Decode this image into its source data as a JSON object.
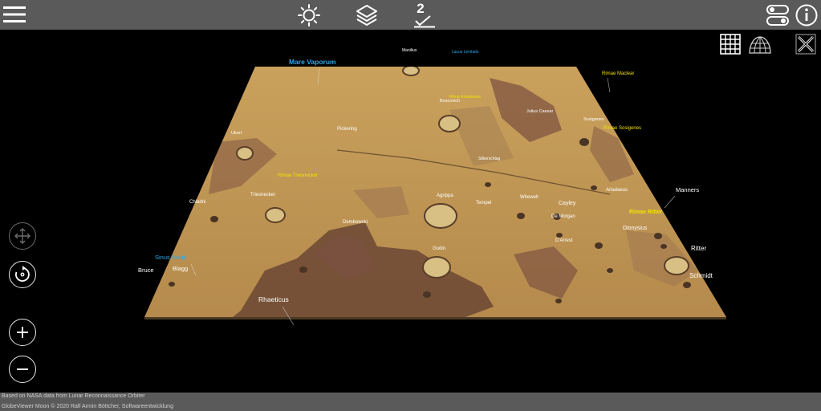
{
  "toolbar": {
    "menu_icon": "hamburger-icon",
    "sun_icon": "sun-icon",
    "layers_icon": "layers-icon",
    "exaggeration_value": "2",
    "settings_icon": "toggle-switches-icon",
    "info_icon": "info-icon"
  },
  "view_controls": {
    "grid_icon": "grid-icon",
    "globe_grid_icon": "globe-grid-icon",
    "close_icon": "close-x-icon"
  },
  "nav_controls": {
    "pan_icon": "pan-arrows-icon",
    "rotate_icon": "rotate-icon",
    "zoom_in_icon": "plus-icon",
    "zoom_out_icon": "minus-icon"
  },
  "colors": {
    "bar": "#5a5a5a",
    "label_white": "#ffffff",
    "label_yellow": "#f2e300",
    "label_blue": "#29a8f0"
  },
  "labels": [
    {
      "text": "Mare Vaporum",
      "color": "b"
    },
    {
      "text": "Manilius",
      "color": "w"
    },
    {
      "text": "Lacus Lenitatis",
      "color": "b"
    },
    {
      "text": "Rimae Maclear",
      "color": "y"
    },
    {
      "text": "Boscovich",
      "color": "w"
    },
    {
      "text": "Rima Ariadaeus",
      "color": "y"
    },
    {
      "text": "Julius Caesar",
      "color": "w"
    },
    {
      "text": "Sosigenes",
      "color": "w"
    },
    {
      "text": "Rimae Sosigenes",
      "color": "y"
    },
    {
      "text": "Pickering",
      "color": "w"
    },
    {
      "text": "Ukert",
      "color": "w"
    },
    {
      "text": "Silberschlag",
      "color": "w"
    },
    {
      "text": "Rimae Triesnecker",
      "color": "y"
    },
    {
      "text": "Triesnecker",
      "color": "w"
    },
    {
      "text": "Ariadaeus",
      "color": "w"
    },
    {
      "text": "Manners",
      "color": "w"
    },
    {
      "text": "Chladni",
      "color": "w"
    },
    {
      "text": "Agrippa",
      "color": "w"
    },
    {
      "text": "Tempel",
      "color": "w"
    },
    {
      "text": "Whewell",
      "color": "w"
    },
    {
      "text": "Cayley",
      "color": "w"
    },
    {
      "text": "Rimae Ritter",
      "color": "y"
    },
    {
      "text": "Dembowski",
      "color": "w"
    },
    {
      "text": "De Morgan",
      "color": "w"
    },
    {
      "text": "Dionysius",
      "color": "w"
    },
    {
      "text": "D'Arrest",
      "color": "w"
    },
    {
      "text": "Godin",
      "color": "w"
    },
    {
      "text": "Ritter",
      "color": "w"
    },
    {
      "text": "Sinus Medii",
      "color": "b"
    },
    {
      "text": "Schmidt",
      "color": "w"
    },
    {
      "text": "Bruce",
      "color": "w"
    },
    {
      "text": "Blagg",
      "color": "w"
    },
    {
      "text": "Rhaeticus",
      "color": "w"
    }
  ],
  "credits": {
    "line1": "Based on NASA data from Lunar Reconnaissance Orbiter",
    "line2": "GlobeViewer Moon © 2020 Ralf Armin Böttcher, Softwareentwicklung"
  }
}
